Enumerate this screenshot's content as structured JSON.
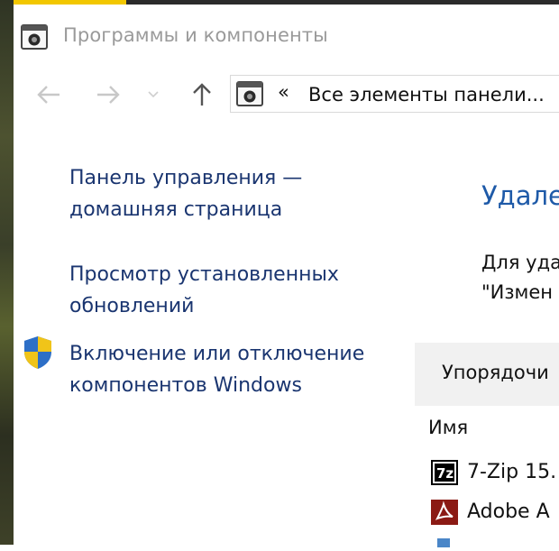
{
  "window": {
    "title": "Программы и компоненты"
  },
  "navigation": {
    "back_icon": "arrow-left-icon",
    "forward_icon": "arrow-right-icon",
    "recent_icon": "chevron-down-icon",
    "up_icon": "arrow-up-icon",
    "address_chevron": "«",
    "address_text": "Все элементы панели..."
  },
  "sidebar": {
    "items": [
      {
        "label": "Панель управления —\nдомашняя страница"
      },
      {
        "label": "Просмотр установленных\nобновлений"
      },
      {
        "label": "Включение или отключение\nкомпонентов Windows",
        "icon": "shield-icon"
      }
    ]
  },
  "main": {
    "title": "Удале",
    "description": "Для уда\n\"Измен",
    "toolbar_label": "Упорядочи",
    "column_name": "Имя",
    "programs": [
      {
        "name": "7-Zip 15.",
        "icon": "7zip-icon"
      },
      {
        "name": "Adobe A",
        "icon": "adobe-acrobat-icon"
      }
    ]
  },
  "colors": {
    "link": "#1a3570",
    "heading": "#1e5aa8",
    "title_text": "#9a9a9a",
    "toolbar_bg": "#f1f1f1",
    "accent_yellow": "#f2c700"
  }
}
